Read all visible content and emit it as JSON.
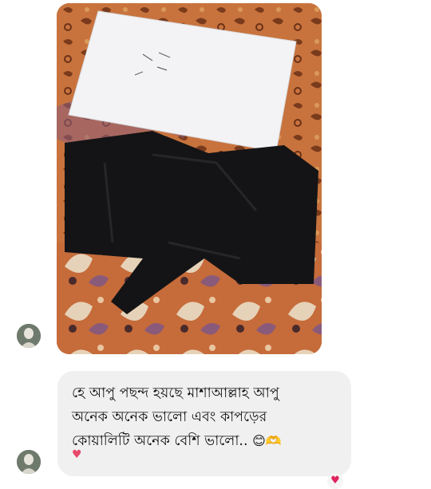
{
  "thread": {
    "photo_message": {
      "image_alt": "Photo of black fabric with a white parcel envelope on an orange patterned cloth"
    },
    "text_message": {
      "text": "হে আপু পছন্দ হয়ছে মাশাআল্লাহ আপু\nঅনেক অনেক ভালো এবং কাপড়ের\nকোয়ালিটি অনেক বেশি ভালো..",
      "emojis": "😊🫶",
      "reaction_heart": "♥"
    },
    "corner_reaction": "♥"
  },
  "colors": {
    "bubble_bg": "#f0f0f0",
    "heart": "#e0245e",
    "cloth_orange": "#c9703a"
  }
}
